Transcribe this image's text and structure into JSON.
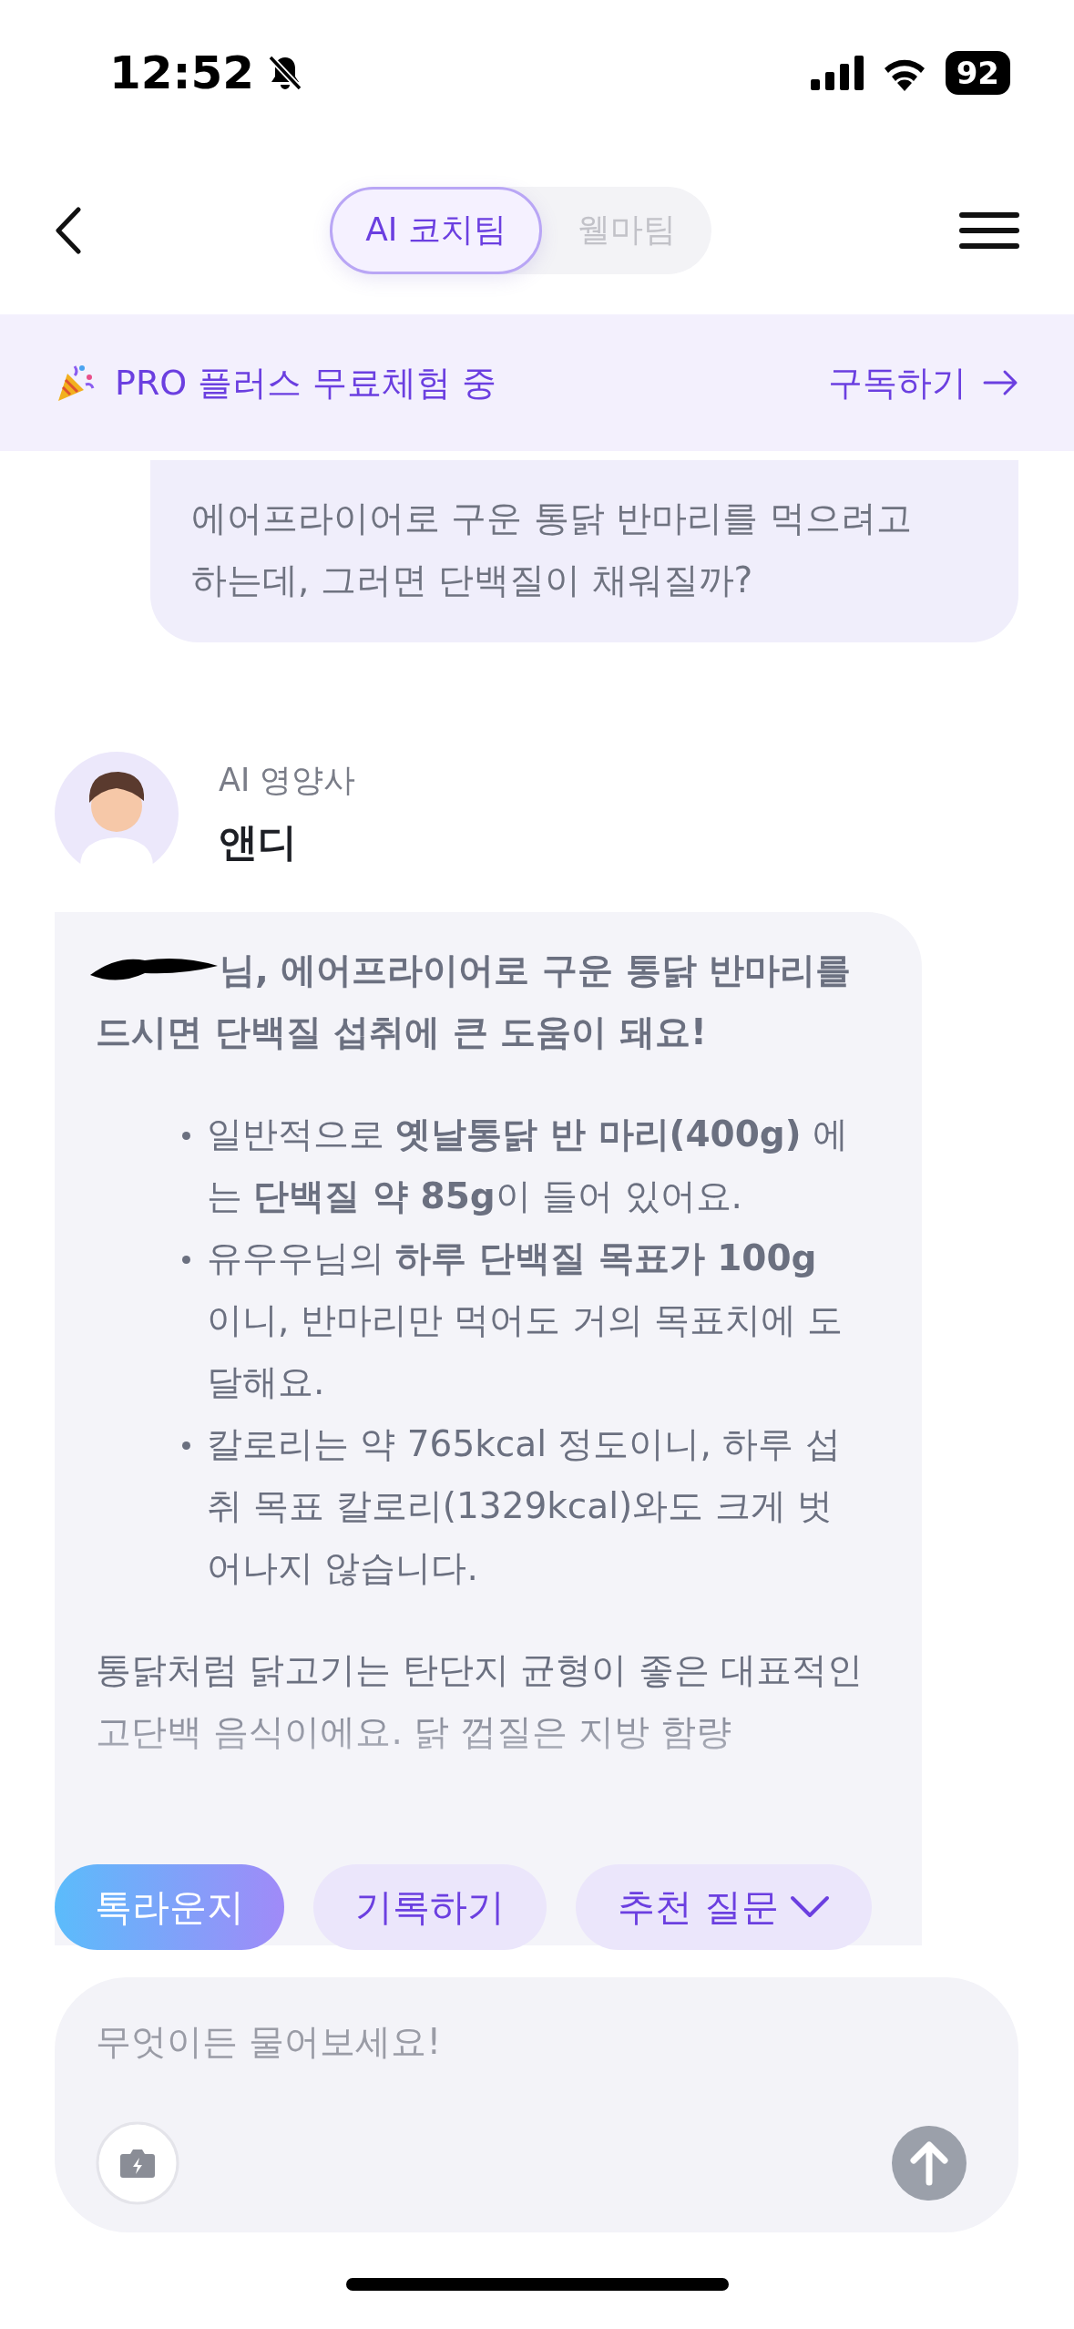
{
  "status_bar": {
    "time": "12:52",
    "battery": "92"
  },
  "nav": {
    "tabs": [
      {
        "label": "AI 코치팀",
        "selected": true
      },
      {
        "label": "웰마팀",
        "selected": false
      }
    ]
  },
  "banner": {
    "text": "PRO 플러스 무료체험 중",
    "action": "구독하기"
  },
  "messages": [
    {
      "kind": "user",
      "text": "에어프라이어로 구운 통닭 반마리를 먹으려고 하는데, 그러면 단백질이 채워질까?"
    },
    {
      "kind": "bot",
      "role": "AI 영양사",
      "name": "앤디",
      "intro_lines": [
        "님, 에어프라이어로 구운 통닭 반마리를",
        "드시면 단백질 섭취에 큰 도움이 돼요!"
      ],
      "bullets": [
        "일반적으로 **옛날통닭 반 마리(400g)** 에는 **단백질 약 85g**이 들어 있어요.",
        "유우우님의 **하루 단백질 목표가 100g** 이니, 반마리만 먹어도 거의 목표치에 도달해요.",
        "칼로리는 약 765kcal 정도이니, 하루 섭취 목표 칼로리(1329kcal)와도 크게 벗어나지 않습니다."
      ],
      "paragraph": "통닭처럼 닭고기는 탄단지 균형이 좋은 대표적인 고단백 음식이에요. 닭 껍질은 지방 함량"
    }
  ],
  "quick_actions": [
    {
      "label": "톡라운지",
      "kind": "primary"
    },
    {
      "label": "기록하기",
      "kind": "secondary"
    },
    {
      "label": "추천 질문",
      "kind": "dropdown"
    }
  ],
  "input": {
    "placeholder": "무엇이든 물어보세요!"
  }
}
